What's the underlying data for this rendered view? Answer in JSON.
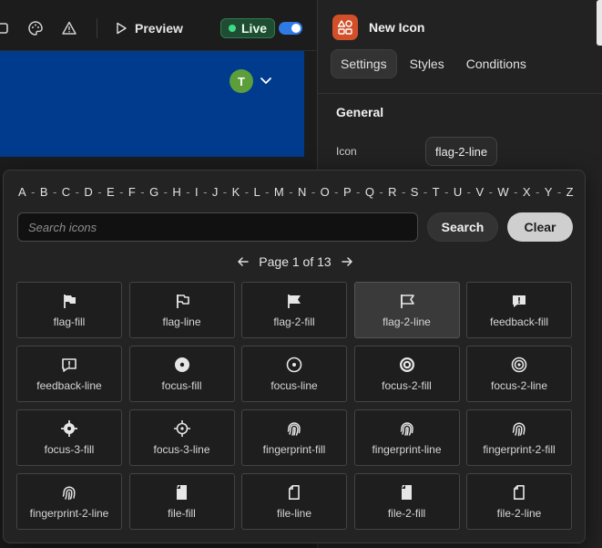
{
  "toolbar": {
    "preview_label": "Preview",
    "live_label": "Live",
    "avatar_initial": "T"
  },
  "panel": {
    "title": "New Icon",
    "tabs": [
      {
        "label": "Settings",
        "active": true
      },
      {
        "label": "Styles",
        "active": false
      },
      {
        "label": "Conditions",
        "active": false
      }
    ],
    "section_title": "General",
    "icon_field_label": "Icon",
    "icon_field_value": "flag-2-line"
  },
  "picker": {
    "alphabet": [
      "A",
      "B",
      "C",
      "D",
      "E",
      "F",
      "G",
      "H",
      "I",
      "J",
      "K",
      "L",
      "M",
      "N",
      "O",
      "P",
      "Q",
      "R",
      "S",
      "T",
      "U",
      "V",
      "W",
      "X",
      "Y",
      "Z"
    ],
    "search_placeholder": "Search icons",
    "search_button": "Search",
    "clear_button": "Clear",
    "page_label": "Page 1 of 13",
    "selected": "flag-2-line",
    "icons": [
      {
        "name": "flag-fill",
        "glyph": "flag-fill"
      },
      {
        "name": "flag-line",
        "glyph": "flag-line"
      },
      {
        "name": "flag-2-fill",
        "glyph": "flag2-fill"
      },
      {
        "name": "flag-2-line",
        "glyph": "flag2-line"
      },
      {
        "name": "feedback-fill",
        "glyph": "feedback-fill"
      },
      {
        "name": "feedback-line",
        "glyph": "feedback-line"
      },
      {
        "name": "focus-fill",
        "glyph": "focus-fill"
      },
      {
        "name": "focus-line",
        "glyph": "focus-line"
      },
      {
        "name": "focus-2-fill",
        "glyph": "focus2-fill"
      },
      {
        "name": "focus-2-line",
        "glyph": "focus2-line"
      },
      {
        "name": "focus-3-fill",
        "glyph": "focus3-fill"
      },
      {
        "name": "focus-3-line",
        "glyph": "focus3-line"
      },
      {
        "name": "fingerprint-fill",
        "glyph": "fingerprint"
      },
      {
        "name": "fingerprint-line",
        "glyph": "fingerprint"
      },
      {
        "name": "fingerprint-2-fill",
        "glyph": "fingerprint2"
      },
      {
        "name": "fingerprint-2-line",
        "glyph": "fingerprint2"
      },
      {
        "name": "file-fill",
        "glyph": "file-fill"
      },
      {
        "name": "file-line",
        "glyph": "file-line"
      },
      {
        "name": "file-2-fill",
        "glyph": "file-fill"
      },
      {
        "name": "file-2-line",
        "glyph": "file-line"
      }
    ]
  },
  "colors": {
    "canvas_header": "#003b8e",
    "live_green": "#3ddc84",
    "toggle_blue": "#2f7ae5",
    "logo_orange": "#d1502a"
  }
}
